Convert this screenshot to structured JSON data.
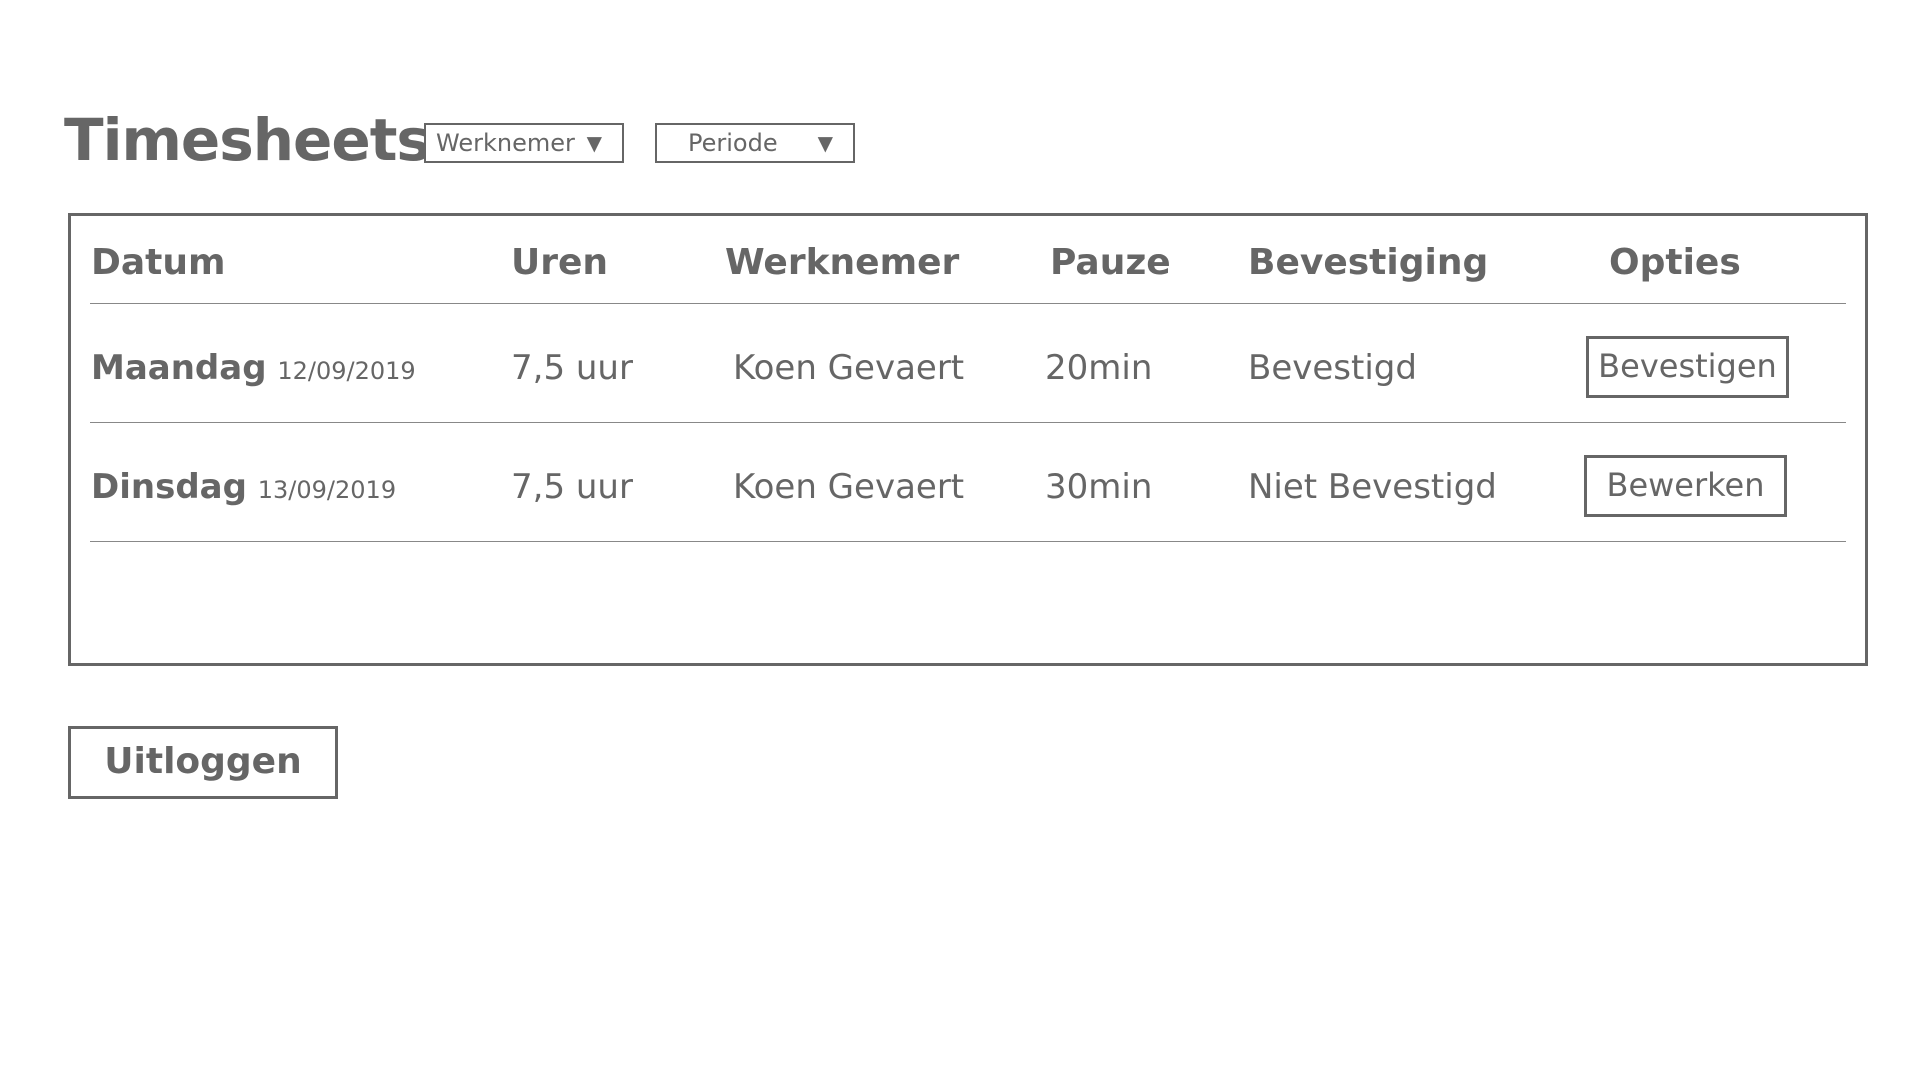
{
  "page": {
    "title": "Timesheets"
  },
  "filters": {
    "employee": {
      "label": "Werknemer",
      "arrow": "▼"
    },
    "period": {
      "label": "Periode",
      "arrow": "▼"
    }
  },
  "table": {
    "headers": {
      "date": "Datum",
      "hours": "Uren",
      "employee": "Werknemer",
      "break": "Pauze",
      "confirmation": "Bevestiging",
      "options": "Opties"
    },
    "rows": [
      {
        "day": "Maandag",
        "date": "12/09/2019",
        "hours": "7,5 uur",
        "employee": "Koen Gevaert",
        "break": "20min",
        "status": "Bevestigd",
        "action": "Bevestigen"
      },
      {
        "day": "Dinsdag",
        "date": "13/09/2019",
        "hours": "7,5 uur",
        "employee": "Koen Gevaert",
        "break": "30min",
        "status": "Niet Bevestigd",
        "action": "Bewerken"
      }
    ]
  },
  "footer": {
    "logout_label": "Uitloggen"
  },
  "colors": {
    "text": "#666666",
    "border": "#666666",
    "background": "#ffffff"
  }
}
